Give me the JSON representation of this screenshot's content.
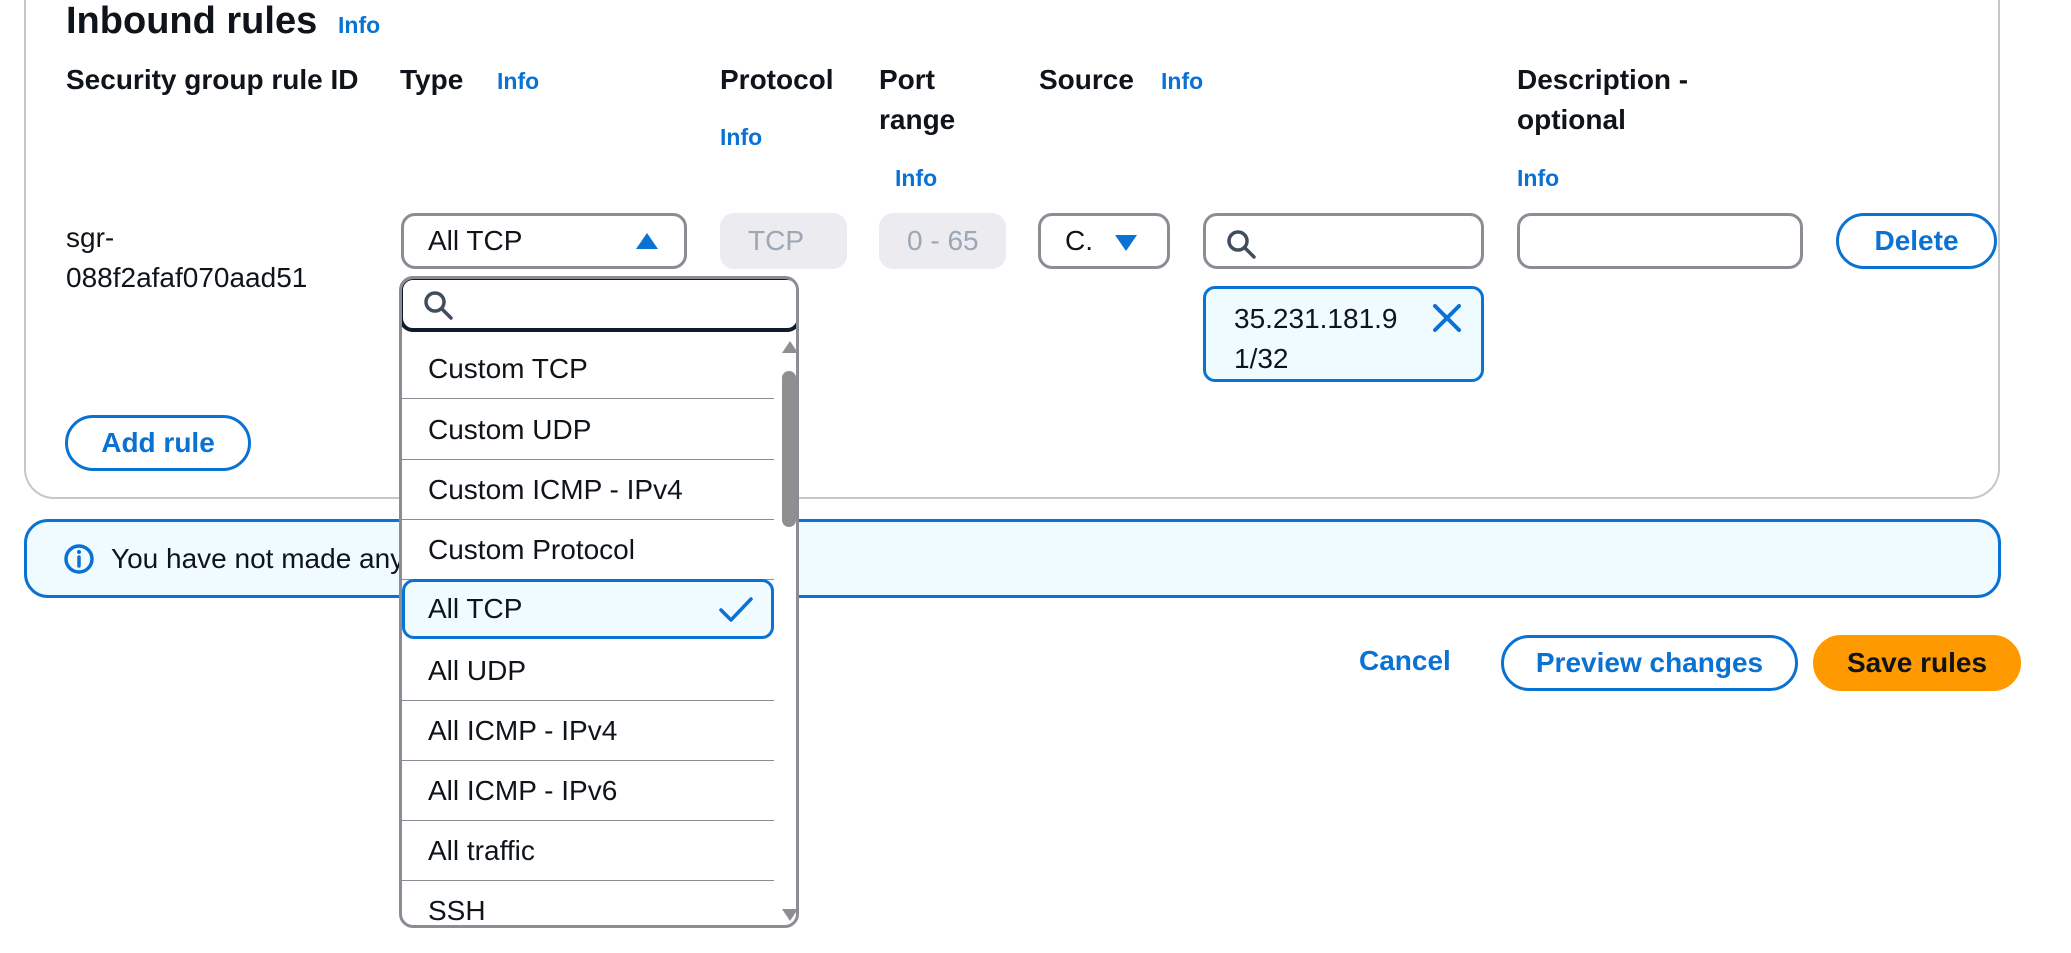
{
  "section": {
    "title": "Inbound rules",
    "info": "Info"
  },
  "columns": {
    "rule_id": "Security group rule ID",
    "type": "Type",
    "type_info": "Info",
    "protocol": "Protocol",
    "protocol_info": "Info",
    "port_range_line1": "Port",
    "port_range_line2": "range",
    "port_info": "Info",
    "source": "Source",
    "source_info": "Info",
    "description_line1": "Description -",
    "description_line2": "optional",
    "description_info": "Info"
  },
  "rule": {
    "id_line1": "sgr-",
    "id_line2": "088f2afaf070aad51",
    "type_value": "All TCP",
    "protocol_value": "TCP",
    "port_value": "0 - 65",
    "source_value": "C.",
    "source_search_value": "",
    "cidr_token_line1": "35.231.181.9",
    "cidr_token_line2": "1/32",
    "description_value": "",
    "delete_label": "Delete"
  },
  "add_rule_label": "Add rule",
  "flash": {
    "text": "You have not made any"
  },
  "actions": {
    "cancel": "Cancel",
    "preview": "Preview changes",
    "save": "Save rules"
  },
  "type_dropdown": {
    "search_value": "",
    "options": [
      "Custom TCP",
      "Custom UDP",
      "Custom ICMP - IPv4",
      "Custom Protocol",
      "All TCP",
      "All UDP",
      "All ICMP - IPv4",
      "All ICMP - IPv6",
      "All traffic",
      "SSH"
    ],
    "selected": "All TCP"
  },
  "colors": {
    "accent": "#0972d3",
    "primary_button": "#ff9900",
    "flash_bg": "#f0fbff"
  },
  "icons": {
    "search": "search-icon",
    "caret_up": "caret-up-icon",
    "caret_down": "caret-down-icon",
    "remove": "close-icon",
    "info": "info-circle-icon",
    "check": "check-icon"
  }
}
